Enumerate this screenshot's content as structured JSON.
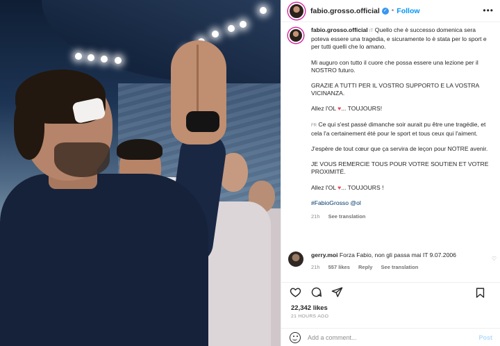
{
  "header": {
    "username": "fabio.grosso.official",
    "separator": "•",
    "follow_label": "Follow",
    "more_label": "•••"
  },
  "caption": {
    "username": "fabio.grosso.official",
    "lang_it": "IT",
    "p1": "Quello che è successo domenica sera poteva essere una tragedia, e sicuramente lo è stata per lo sport e per tutti quelli che lo amano.",
    "p2": "Mi auguro con tutto il cuore che possa essere una lezione per il NOSTRO futuro.",
    "p3": "GRAZIE A TUTTI PER IL VOSTRO SUPPORTO E LA VOSTRA VICINANZA.",
    "p4_pre": "Allez l'OL ",
    "p4_post": "... TOUJOURS!",
    "lang_fr": "FR",
    "p5": "Ce qui s'est passé dimanche soir aurait pu être une tragédie, et cela l'a certainement été pour le sport et tous ceux qui l'aiment.",
    "p6": "J'espère de tout cœur que ça servira de leçon pour NOTRE avenir.",
    "p7": "JE VOUS REMERCIE TOUS POUR VOTRE SOUTIEN ET VOTRE PROXIMITÉ.",
    "p8_pre": "Allez l'OL ",
    "p8_post": "... TOUJOURS !",
    "tags": "#FabioGrosso @ol",
    "time": "21h",
    "see_translation": "See translation"
  },
  "comment": {
    "username": "gerry.moi",
    "text": "Forza Fabio, non gli passa mai IT 9.07.2006",
    "time": "21h",
    "likes": "557 likes",
    "reply": "Reply",
    "see_translation": "See translation"
  },
  "footer": {
    "likes": "22,342 likes",
    "time_ago": "21 HOURS AGO",
    "add_comment_placeholder": "Add a comment...",
    "post_label": "Post"
  },
  "colors": {
    "accent": "#0095f6",
    "heart": "#ed4956",
    "verified": "#3897f0"
  },
  "icons": [
    "heart-icon",
    "comment-icon",
    "share-icon",
    "bookmark-icon",
    "emoji-icon",
    "verified-badge-icon",
    "more-icon"
  ]
}
